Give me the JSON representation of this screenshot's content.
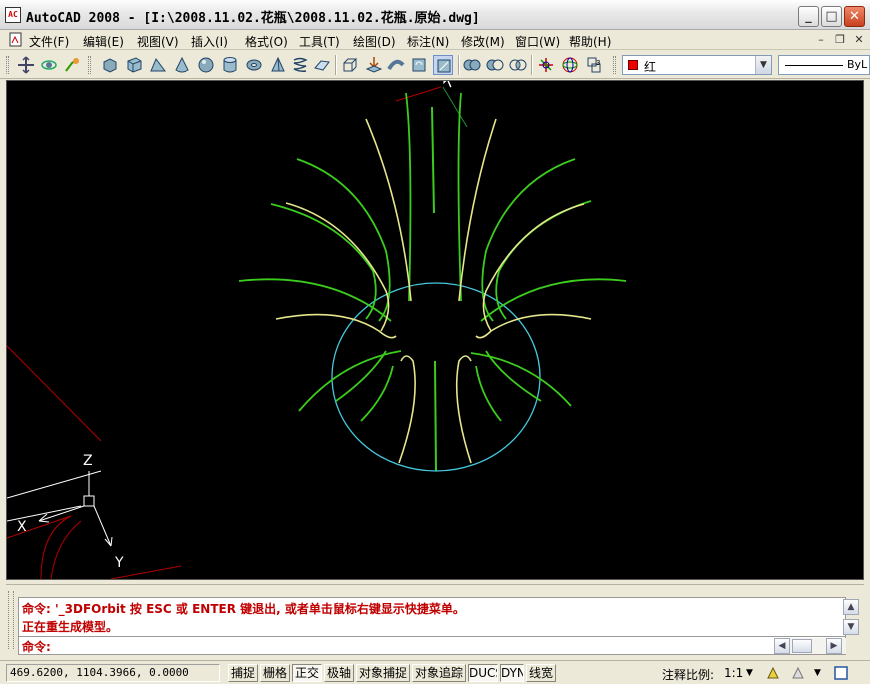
{
  "window": {
    "title": "AutoCAD 2008 - [I:\\2008.11.02.花瓶\\2008.11.02.花瓶.原始.dwg]",
    "app_icon_text": "AC",
    "minimize": "_",
    "maximize": "□",
    "close": "✕"
  },
  "menu": {
    "items": [
      "文件(F)",
      "编辑(E)",
      "视图(V)",
      "插入(I)",
      "格式(O)",
      "工具(T)",
      "绘图(D)",
      "标注(N)",
      "修改(M)",
      "窗口(W)",
      "帮助(H)"
    ],
    "mdi_minimize": "–",
    "mdi_restore": "❐",
    "mdi_close": "✕"
  },
  "toolbar": {
    "color_value": "红",
    "color_hex": "#e00000",
    "linetype_value": "ByL",
    "dropdown_arrow": "▼"
  },
  "viewport": {
    "background": "#000000",
    "ucs_x_label": "X",
    "ucs_y_label": "Y",
    "ucs_z_label": "Z",
    "colors": {
      "green": "#3ccc1e",
      "yellow": "#e6e68c",
      "cyan": "#46c8dc",
      "red": "#b40000",
      "white": "#ffffff"
    }
  },
  "command": {
    "history": [
      "命令: '_3DFOrbit 按 ESC 或 ENTER 键退出, 或者单击鼠标右键显示快捷菜单。",
      "正在重生成模型。"
    ],
    "prompt": "命令:",
    "scroll_up": "▲",
    "scroll_down": "▼",
    "scroll_left": "◀",
    "scroll_right": "▶"
  },
  "status": {
    "coordinates": "469.6200, 1104.3966, 0.0000",
    "toggles": [
      "捕捉",
      "栅格",
      "正交",
      "极轴",
      "对象捕捉",
      "对象追踪",
      "DUCS",
      "DYN",
      "线宽"
    ],
    "annotation_scale_label": "注释比例:",
    "annotation_scale_value": "1:1",
    "scale_arrow": "▼"
  }
}
